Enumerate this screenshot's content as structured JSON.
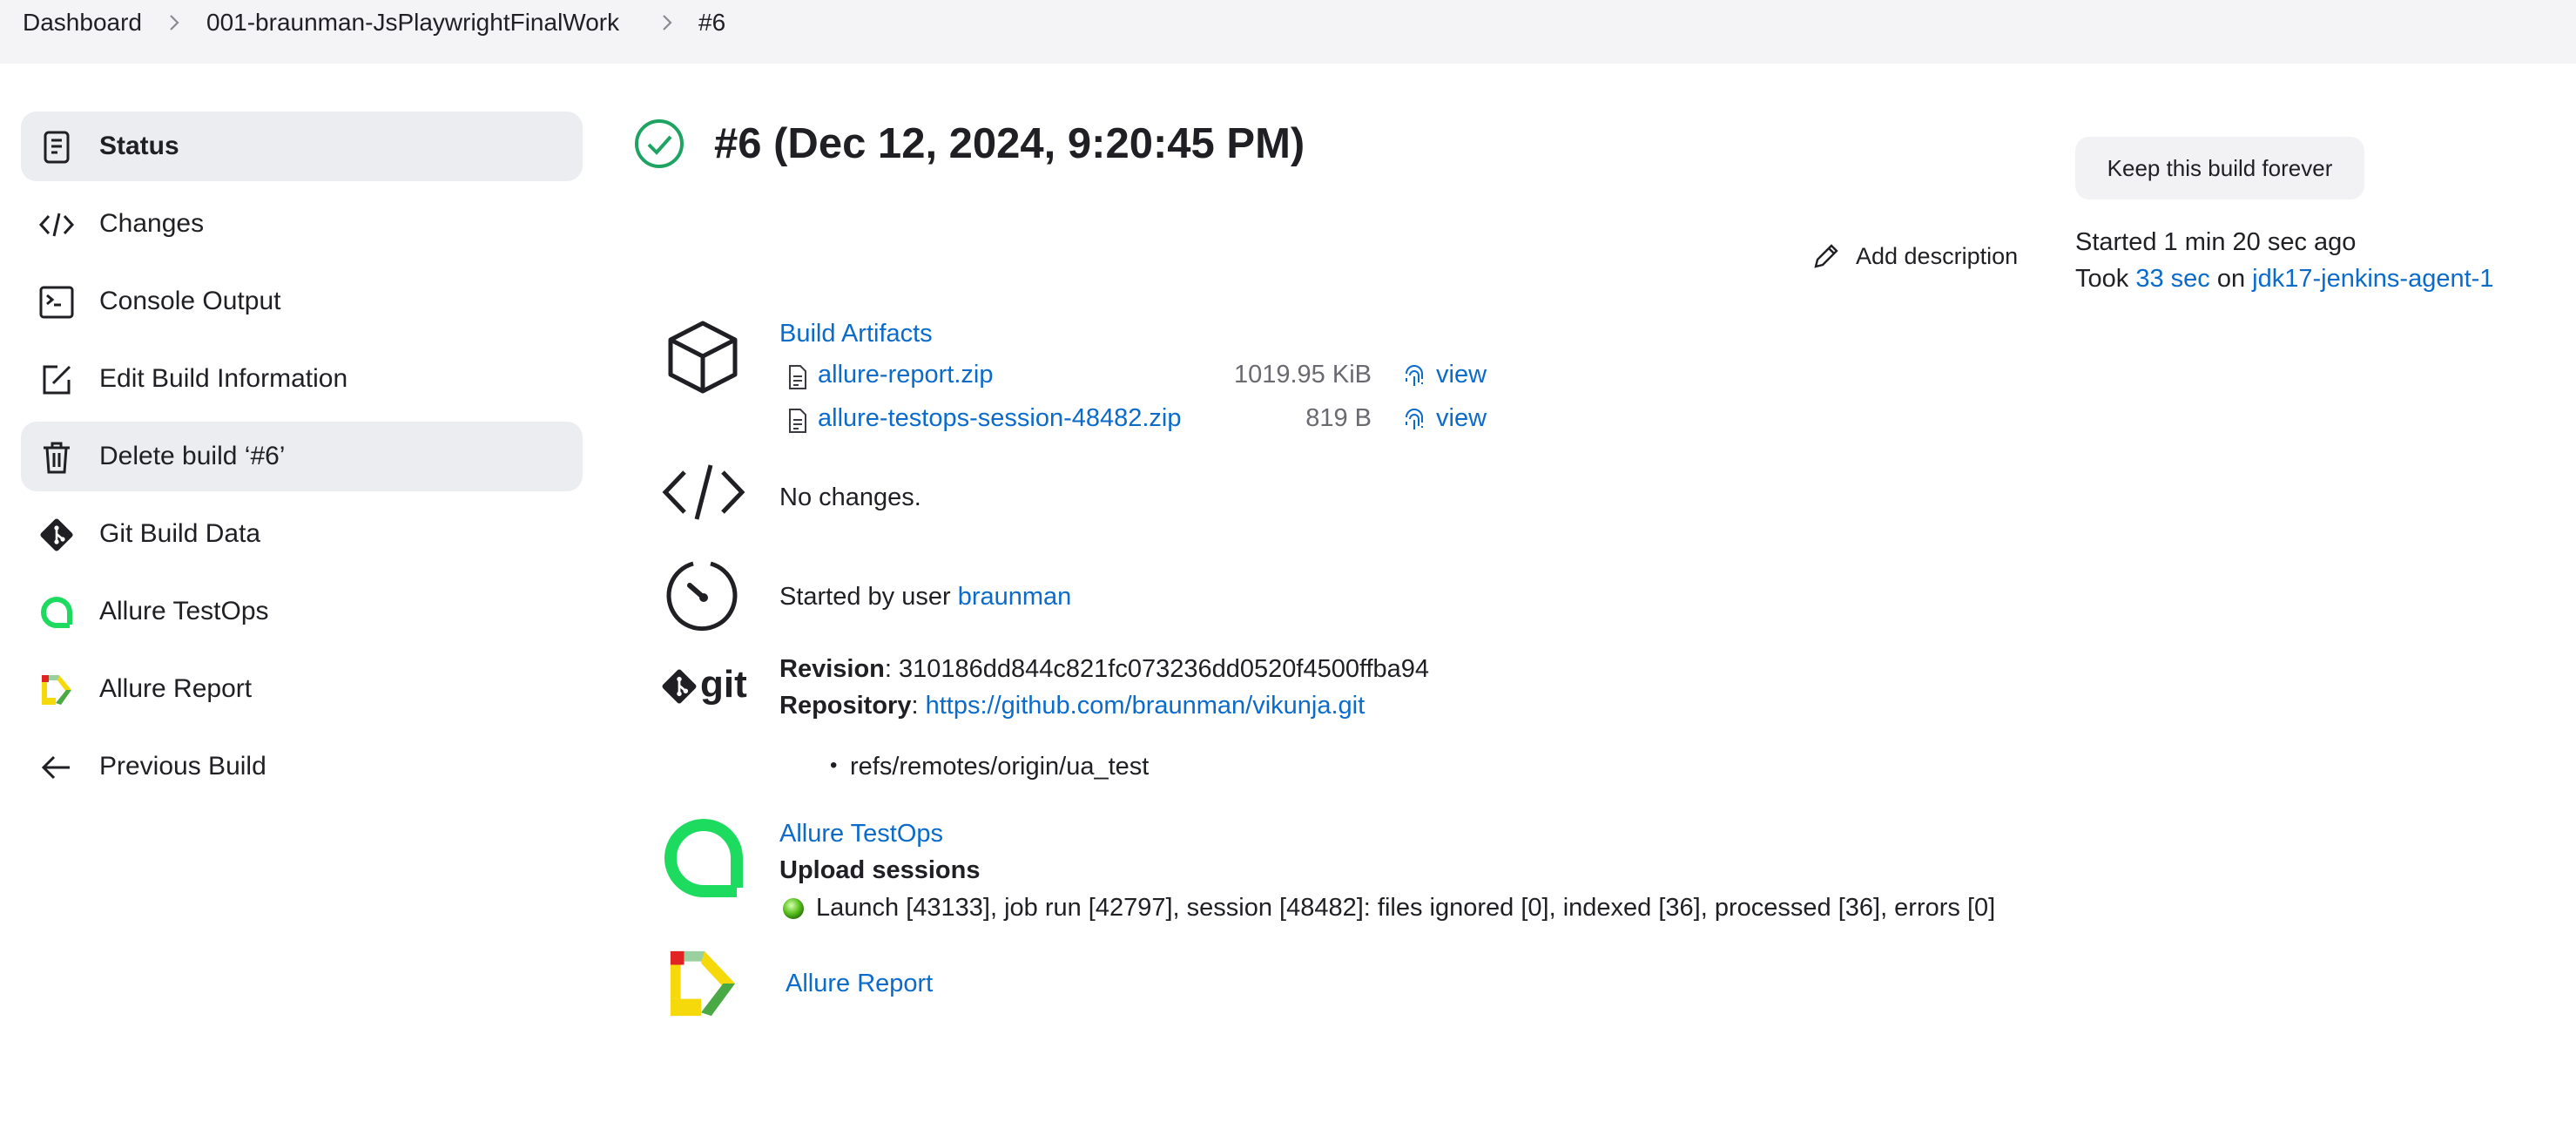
{
  "breadcrumb": {
    "items": [
      "Dashboard",
      "001-braunman-JsPlaywrightFinalWork",
      "#6"
    ]
  },
  "sidebar": {
    "items": [
      {
        "label": "Status",
        "icon": "document-icon"
      },
      {
        "label": "Changes",
        "icon": "code-icon"
      },
      {
        "label": "Console Output",
        "icon": "terminal-icon"
      },
      {
        "label": "Edit Build Information",
        "icon": "edit-icon"
      },
      {
        "label": "Delete build ‘#6’",
        "icon": "trash-icon"
      },
      {
        "label": "Git Build Data",
        "icon": "git-icon"
      },
      {
        "label": "Allure TestOps",
        "icon": "allure-testops-icon"
      },
      {
        "label": "Allure Report",
        "icon": "allure-report-icon"
      },
      {
        "label": "Previous Build",
        "icon": "arrow-left-icon"
      }
    ]
  },
  "build": {
    "title": "#6 (Dec 12, 2024, 9:20:45 PM)",
    "status": "success",
    "keep_label": "Keep this build forever",
    "add_description": "Add description",
    "started": "Started 1 min 20 sec ago",
    "took_prefix": "Took",
    "took_duration": "33 sec",
    "took_on": "on",
    "agent": "jdk17-jenkins-agent-1"
  },
  "artifacts": {
    "heading": "Build Artifacts",
    "files": [
      {
        "name": "allure-report.zip",
        "size": "1019.95 KiB",
        "view": "view"
      },
      {
        "name": "allure-testops-session-48482.zip",
        "size": "819 B",
        "view": "view"
      }
    ]
  },
  "changes": {
    "text": "No changes."
  },
  "cause": {
    "prefix": "Started by user",
    "user": "braunman"
  },
  "git": {
    "revision_label": "Revision",
    "revision": ": 310186dd844c821fc073236dd0520f4500ffba94",
    "repo_label": "Repository",
    "repo_colon": ":",
    "repo_url": "https://github.com/braunman/vikunja.git",
    "branch": "refs/remotes/origin/ua_test",
    "logo_text": "git"
  },
  "testops": {
    "link": "Allure TestOps",
    "heading": "Upload sessions",
    "session": "Launch [43133], job run [42797], session [48482]: files ignored [0], indexed [36], processed [36], errors [0]"
  },
  "allure_report": {
    "link": "Allure Report"
  },
  "colors": {
    "accent": "#0b6bcb",
    "success": "#1ea362",
    "testops_green": "#1ddb5f"
  }
}
